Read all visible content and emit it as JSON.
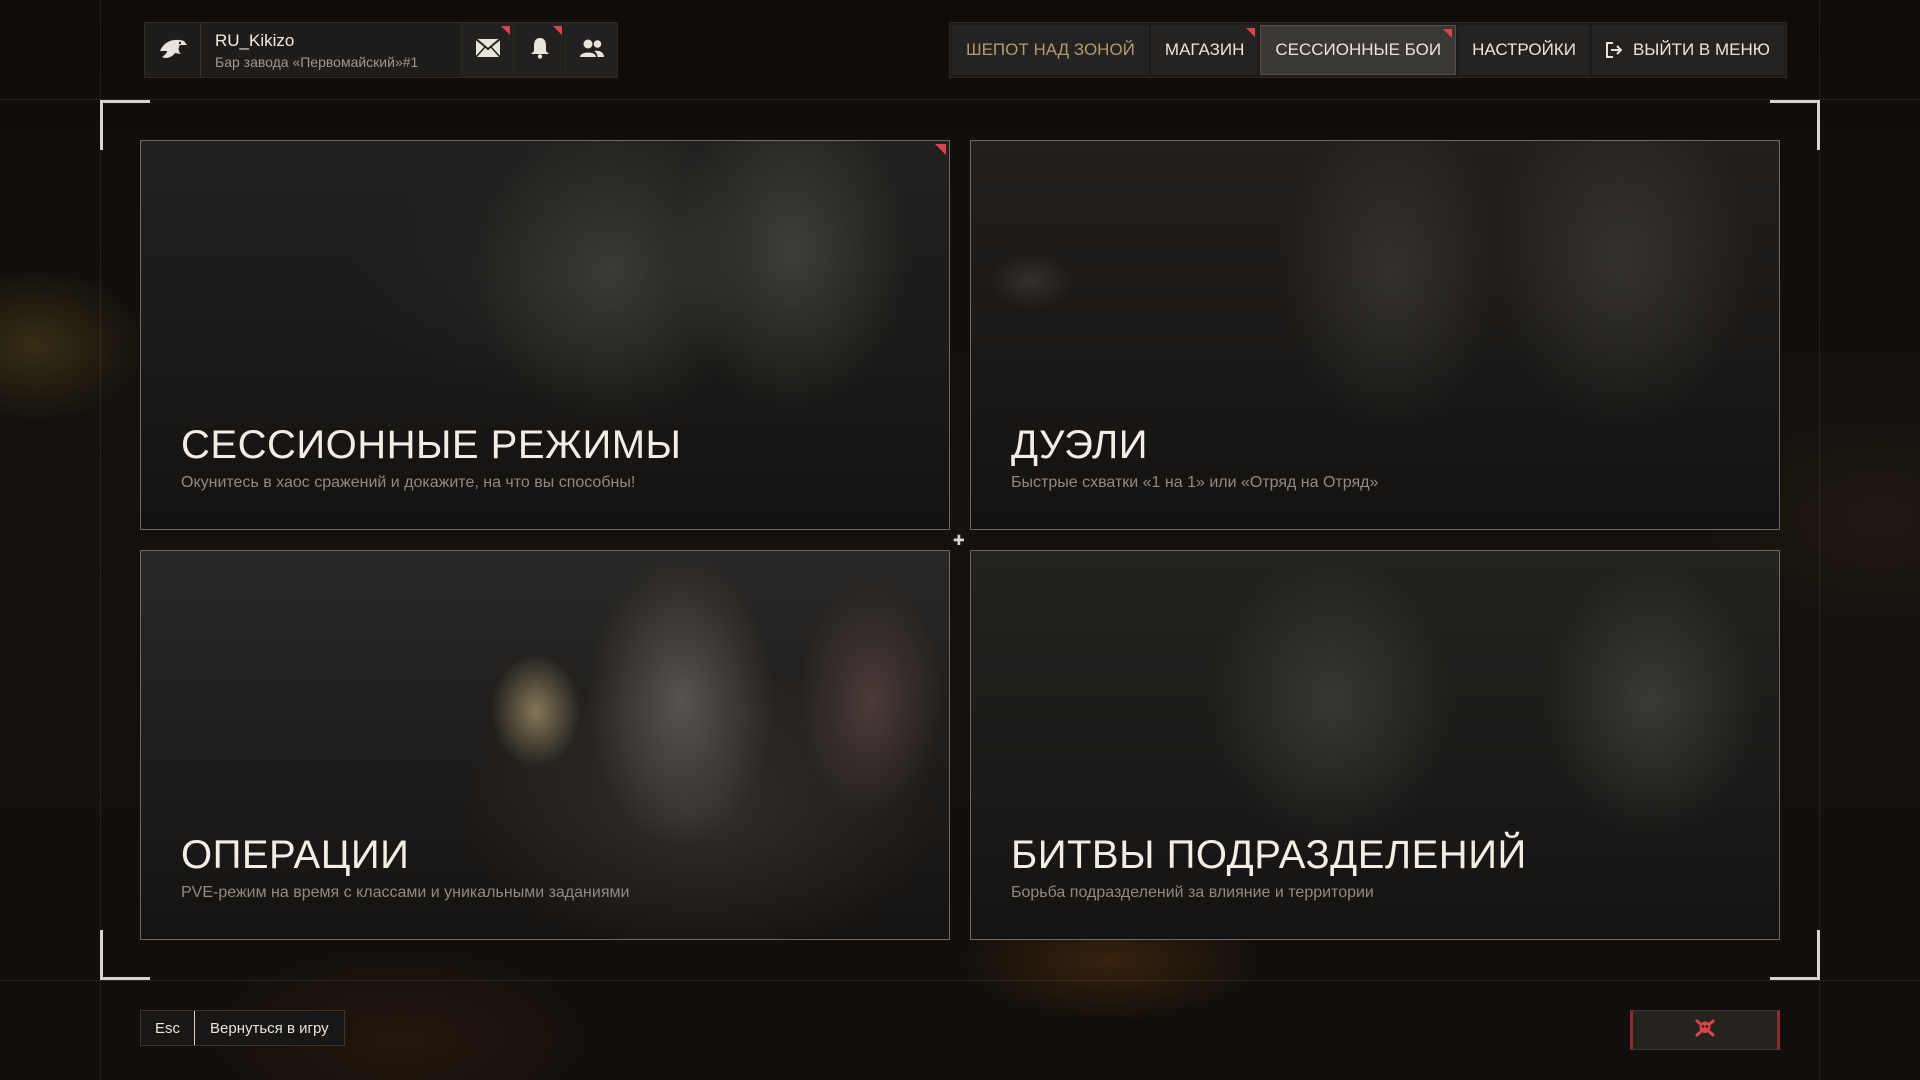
{
  "profile": {
    "username": "RU_Kikizo",
    "location": "Бар завода «Первомайский»#1",
    "icons": [
      "eagle-logo-icon",
      "mail-icon",
      "bell-icon",
      "friends-icon"
    ]
  },
  "nav": {
    "items": [
      {
        "label": "ШЕПОТ НАД ЗОНОЙ",
        "accent": "gold"
      },
      {
        "label": "МАГАЗИН",
        "marked": true
      },
      {
        "label": "СЕССИОННЫЕ БОИ",
        "marked": true,
        "active": true
      },
      {
        "label": "НАСТРОЙКИ"
      },
      {
        "label": "ВЫЙТИ В МЕНЮ",
        "icon": "exit-icon"
      }
    ]
  },
  "cards": [
    {
      "title": "СЕССИОННЫЕ РЕЖИМЫ",
      "desc": "Окунитесь в хаос сражений и докажите, на что вы способны!",
      "marked": true
    },
    {
      "title": "ДУЭЛИ",
      "desc": "Быстрые схватки «1 на 1» или «Отряд на Отряд»"
    },
    {
      "title": "ОПЕРАЦИИ",
      "desc": "PVE-режим на время с классами и уникальными заданиями"
    },
    {
      "title": "БИТВЫ ПОДРАЗДЕЛЕНИЙ",
      "desc": "Борьба подразделений за влияние и территории"
    }
  ],
  "footer": {
    "esc_key": "Esc",
    "esc_label": "Вернуться в игру",
    "report_icon": "skull-crossbones-icon"
  },
  "colors": {
    "accent_red": "#d9454a",
    "gold": "#b39a6c",
    "background": "#130f0c"
  }
}
